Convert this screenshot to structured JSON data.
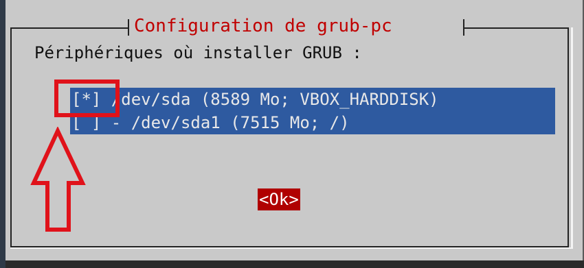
{
  "dialog": {
    "title": "Configuration de grub-pc",
    "prompt": "Périphériques où installer GRUB :",
    "devices": [
      {
        "label": "[*] /dev/sda (8589 Mo; VBOX_HARDDISK)",
        "checked": true
      },
      {
        "label": "[ ] - /dev/sda1 (7515 Mo; /)",
        "checked": false
      }
    ],
    "ok_label": "<Ok>"
  },
  "colors": {
    "dialog_bg": "#c9c9c9",
    "title": "#c00000",
    "list_selected_bg": "#2e5aa0",
    "ok_bg": "#b00000",
    "annotation": "#e0121a",
    "console_bg": "#2f3a48"
  },
  "annotations": {
    "highlight_target": "checkbox-sda",
    "arrow_icon": "arrow-up-outline-icon"
  }
}
